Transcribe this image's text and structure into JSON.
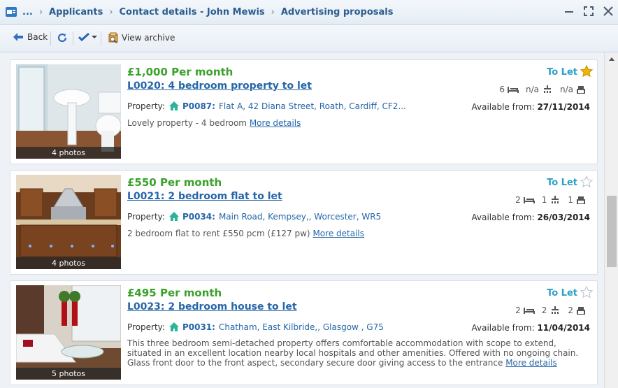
{
  "breadcrumb": {
    "ellipsis": "...",
    "items": [
      "Applicants",
      "Contact details - John Mewis",
      "Advertising proposals"
    ]
  },
  "toolbar": {
    "back_label": "Back",
    "view_archive_label": "View archive"
  },
  "colors": {
    "price": "#3aa22b",
    "link": "#2566a8",
    "status": "#2aa0c9",
    "star_active": "#f3b400"
  },
  "listings": [
    {
      "price": "£1,000 Per month",
      "title": "L0020:  4 bedroom property to let",
      "property_label": "Property:",
      "property_id": "P0087:",
      "property_address": "Flat A, 42 Diana Street, Roath, Cardiff, CF2...",
      "description": "Lovely property - 4 bedroom",
      "more_details": "More details",
      "photos": "4 photos",
      "status": "To Let",
      "starred": true,
      "bedrooms": "6",
      "bathrooms": "n/a",
      "receptions": "n/a",
      "available_label": "Available from:",
      "available_date": "27/11/2014",
      "icon": "bathroom-photo"
    },
    {
      "price": "£550 Per month",
      "title": "L0021:  2 bedroom flat to let",
      "property_label": "Property:",
      "property_id": "P0034:",
      "property_address": "Main Road, Kempsey,, Worcester, WR5",
      "description": "2 bedroom flat to rent £550 pcm (£127 pw)",
      "more_details": "More details",
      "photos": "4 photos",
      "status": "To Let",
      "starred": false,
      "bedrooms": "2",
      "bathrooms": "1",
      "receptions": "1",
      "available_label": "Available from:",
      "available_date": "26/03/2014",
      "icon": "kitchen-photo"
    },
    {
      "price": "£495 Per month",
      "title": "L0023:  2 bedroom house to let",
      "property_label": "Property:",
      "property_id": "P0031:",
      "property_address": "Chatham, East Kilbride,, Glasgow , G75",
      "description": "This three bedroom semi-detached property offers comfortable accommodation with scope to extend, situated in an excellent location nearby local hospitals and other amenities. Offered with no ongoing chain. Glass front door to the front aspect, secondary secure door giving access to the entrance",
      "more_details": "More details",
      "photos": "5 photos",
      "status": "To Let",
      "starred": false,
      "bedrooms": "2",
      "bathrooms": "2",
      "receptions": "2",
      "available_label": "Available from:",
      "available_date": "11/04/2014",
      "icon": "living-room-photo"
    }
  ]
}
